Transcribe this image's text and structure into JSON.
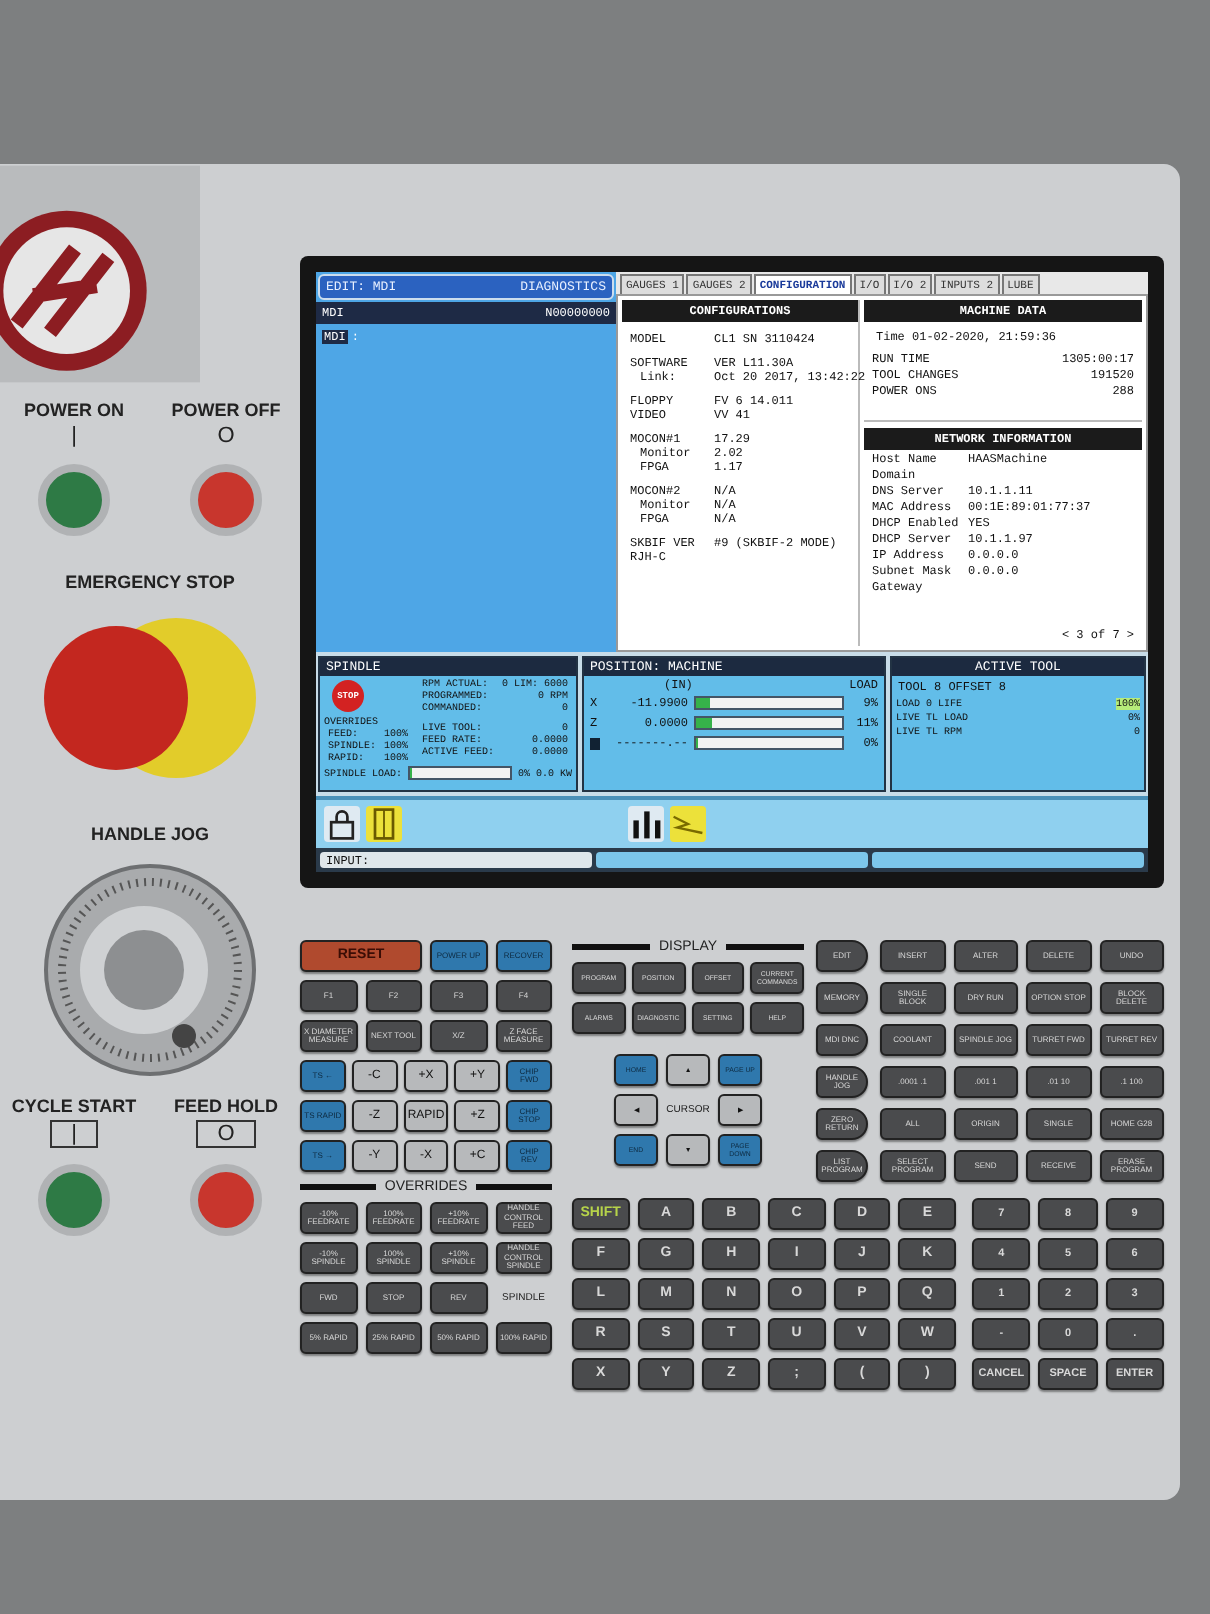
{
  "side_panel": {
    "power_on": {
      "label": "POWER ON",
      "symbol": "|"
    },
    "power_off": {
      "label": "POWER OFF",
      "symbol": "O"
    },
    "emergency_stop": {
      "label": "EMERGENCY STOP"
    },
    "handle_jog": {
      "label": "HANDLE JOG"
    },
    "cycle_start": {
      "label": "CYCLE START",
      "symbol": "|"
    },
    "feed_hold": {
      "label": "FEED HOLD",
      "symbol": "O"
    }
  },
  "screen": {
    "left_pane": {
      "title": "EDIT: MDI",
      "tab": "DIAGNOSTICS",
      "header": "MDI",
      "program": "N00000000",
      "line": {
        "label": "MDI",
        "text": ":"
      }
    },
    "tabs": [
      {
        "label": "GAUGES 1",
        "selected": false
      },
      {
        "label": "GAUGES 2",
        "selected": false
      },
      {
        "label": "CONFIGURATION",
        "selected": true
      },
      {
        "label": "I/O",
        "selected": false
      },
      {
        "label": "I/O 2",
        "selected": false
      },
      {
        "label": "INPUTS 2",
        "selected": false
      },
      {
        "label": "LUBE",
        "selected": false
      }
    ],
    "configurations": {
      "title": "CONFIGURATIONS",
      "groups": [
        [
          {
            "label": "MODEL",
            "value": "CL1   SN   3110424",
            "indent": false
          }
        ],
        [
          {
            "label": "SOFTWARE",
            "value": "VER L11.30A",
            "indent": false
          },
          {
            "label": "Link:",
            "value": "Oct 20 2017, 13:42:22",
            "indent": true
          }
        ],
        [
          {
            "label": "FLOPPY",
            "value": "FV 6  14.011",
            "indent": false
          },
          {
            "label": "VIDEO",
            "value": "VV 41",
            "indent": false
          }
        ],
        [
          {
            "label": "MOCON#1",
            "value": "17.29",
            "indent": false
          },
          {
            "label": "Monitor",
            "value": "2.02",
            "indent": true
          },
          {
            "label": "FPGA",
            "value": "1.17",
            "indent": true
          }
        ],
        [
          {
            "label": "MOCON#2",
            "value": "N/A",
            "indent": false
          },
          {
            "label": "Monitor",
            "value": "N/A",
            "indent": true
          },
          {
            "label": "FPGA",
            "value": "N/A",
            "indent": true
          }
        ],
        [
          {
            "label": "SKBIF VER",
            "value": "#9 (SKBIF-2 MODE)",
            "indent": false
          },
          {
            "label": "RJH-C",
            "indent": false
          }
        ]
      ]
    },
    "machine_data": {
      "title": "MACHINE DATA",
      "time": "Time  01-02-2020, 21:59:36",
      "rows": [
        {
          "label": "RUN TIME",
          "value": "1305:00:17"
        },
        {
          "label": "TOOL CHANGES",
          "value": "191520"
        },
        {
          "label": "POWER ONS",
          "value": "288"
        }
      ]
    },
    "network": {
      "title": "NETWORK INFORMATION",
      "rows": [
        {
          "label": "Host Name",
          "value": "HAASMachine"
        },
        {
          "label": "Domain"
        },
        {
          "label": "DNS Server",
          "value": "10.1.1.11"
        },
        {
          "label": "MAC Address",
          "value": "00:1E:89:01:77:37"
        },
        {
          "label": "DHCP Enabled",
          "value": "YES"
        },
        {
          "label": "DHCP Server",
          "value": "10.1.1.97"
        },
        {
          "label": "IP Address",
          "value": "0.0.0.0"
        },
        {
          "label": "Subnet Mask",
          "value": "0.0.0.0"
        },
        {
          "label": "Gateway"
        }
      ]
    },
    "pager": "< 3 of 7 >",
    "spindle": {
      "title": "SPINDLE",
      "stop": "STOP",
      "rows": [
        {
          "label": "RPM ACTUAL:",
          "value": "0 LIM: 6000"
        },
        {
          "label": "PROGRAMMED:",
          "value": "0      RPM"
        },
        {
          "label": "COMMANDED:",
          "value": "0"
        }
      ],
      "overrides_title": "OVERRIDES",
      "overrides": [
        {
          "label": "FEED:",
          "value": "100%"
        },
        {
          "label": "SPINDLE:",
          "value": "100%"
        },
        {
          "label": "RAPID:",
          "value": "100%"
        }
      ],
      "rows2": [
        {
          "label": "LIVE TOOL:",
          "value": "0"
        },
        {
          "label": "FEED RATE:",
          "value": "0.0000"
        },
        {
          "label": "ACTIVE FEED:",
          "value": "0.0000"
        }
      ],
      "load_label": "SPINDLE LOAD:",
      "load_bar": {
        "level": 0
      },
      "load_reading": "0%",
      "power_reading": "0.0 KW"
    },
    "position": {
      "title": "POSITION: MACHINE",
      "units": "(IN)",
      "load_title": "LOAD",
      "axes": [
        {
          "axis": "X",
          "value": "-11.9900",
          "level": 0.09,
          "load": "9%",
          "cursor": false
        },
        {
          "axis": "Z",
          "value": "0.0000",
          "level": 0.11,
          "load": "11%",
          "cursor": false
        },
        {
          "value": "-------.--",
          "level": 0,
          "load": "0%",
          "cursor": true
        }
      ]
    },
    "active_tool": {
      "title": "ACTIVE TOOL",
      "tool": "TOOL 8  OFFSET 8",
      "rows": [
        {
          "label": "LOAD 0  LIFE",
          "value": "100%",
          "highlighted": true
        },
        {
          "label": "LIVE TL LOAD",
          "value": "0%",
          "highlighted": false
        },
        {
          "label": "LIVE TL RPM",
          "value": "0",
          "highlighted": false
        }
      ]
    },
    "status_icons": [
      {
        "kind": "lock",
        "highlighted": false
      },
      {
        "kind": "door",
        "highlighted": true
      },
      {
        "kind": "bars",
        "highlighted": false
      },
      {
        "kind": "zigzag",
        "highlighted": true
      }
    ],
    "input": {
      "label": "INPUT:"
    }
  },
  "keypad": {
    "left_rows": [
      [
        {
          "label": "RESET",
          "kind": "reset"
        },
        {
          "label": "POWER UP",
          "kind": "blue"
        },
        {
          "label": "RECOVER",
          "kind": "blue"
        }
      ],
      [
        {
          "label": "F1",
          "kind": "dark"
        },
        {
          "label": "F2",
          "kind": "dark"
        },
        {
          "label": "F3",
          "kind": "dark"
        },
        {
          "label": "F4",
          "kind": "dark"
        }
      ],
      [
        {
          "label": "X DIAMETER MEASURE",
          "kind": "dark"
        },
        {
          "label": "NEXT TOOL",
          "kind": "dark"
        },
        {
          "label": "X/Z",
          "kind": "dark"
        },
        {
          "label": "Z FACE MEASURE",
          "kind": "dark"
        }
      ]
    ],
    "jog_rows": [
      [
        {
          "label": "TS ←",
          "kind": "blue"
        },
        {
          "label": "-C",
          "kind": "light"
        },
        {
          "label": "+X",
          "kind": "light"
        },
        {
          "label": "+Y",
          "kind": "light"
        },
        {
          "label": "CHIP FWD",
          "kind": "blue"
        }
      ],
      [
        {
          "label": "TS RAPID",
          "kind": "blue"
        },
        {
          "label": "-Z",
          "kind": "light"
        },
        {
          "label": "RAPID",
          "kind": "light"
        },
        {
          "label": "+Z",
          "kind": "light"
        },
        {
          "label": "CHIP STOP",
          "kind": "blue"
        }
      ],
      [
        {
          "label": "TS →",
          "kind": "blue"
        },
        {
          "label": "-Y",
          "kind": "light"
        },
        {
          "label": "-X",
          "kind": "light"
        },
        {
          "label": "+C",
          "kind": "light"
        },
        {
          "label": "CHIP REV",
          "kind": "blue"
        }
      ]
    ],
    "overrides": {
      "title": "OVERRIDES",
      "rows": [
        [
          {
            "label": "-10% FEEDRATE",
            "kind": "dark"
          },
          {
            "label": "100% FEEDRATE",
            "kind": "dark"
          },
          {
            "label": "+10% FEEDRATE",
            "kind": "dark"
          },
          {
            "label": "HANDLE CONTROL FEED",
            "kind": "dark"
          }
        ],
        [
          {
            "label": "-10% SPINDLE",
            "kind": "dark"
          },
          {
            "label": "100% SPINDLE",
            "kind": "dark"
          },
          {
            "label": "+10% SPINDLE",
            "kind": "dark"
          },
          {
            "label": "HANDLE CONTROL SPINDLE",
            "kind": "dark"
          }
        ],
        [
          {
            "label": "FWD",
            "kind": "dark"
          },
          {
            "label": "STOP",
            "kind": "dark"
          },
          {
            "label": "REV",
            "kind": "dark"
          },
          {
            "label": "SPINDLE",
            "kind": "label"
          }
        ],
        [
          {
            "label": "5% RAPID",
            "kind": "dark"
          },
          {
            "label": "25% RAPID",
            "kind": "dark"
          },
          {
            "label": "50% RAPID",
            "kind": "dark"
          },
          {
            "label": "100% RAPID",
            "kind": "dark"
          }
        ]
      ]
    },
    "display": {
      "title": "DISPLAY",
      "rows": [
        [
          {
            "label": "PROGRAM"
          },
          {
            "label": "POSITION"
          },
          {
            "label": "OFFSET"
          },
          {
            "label": "CURRENT COMMANDS"
          }
        ],
        [
          {
            "label": "ALARMS"
          },
          {
            "label": "DIAGNOSTIC"
          },
          {
            "label": "SETTING"
          },
          {
            "label": "HELP"
          }
        ]
      ]
    },
    "cursor": {
      "label": "CURSOR",
      "keys": [
        {
          "label": "HOME",
          "kind": "blue"
        },
        {
          "label": "▲",
          "kind": "light"
        },
        {
          "label": "PAGE UP",
          "kind": "blue"
        },
        {
          "label": "◀",
          "kind": "light"
        },
        {
          "label": "▶",
          "kind": "light"
        },
        {
          "label": "END",
          "kind": "blue"
        },
        {
          "label": "▼",
          "kind": "light"
        },
        {
          "label": "PAGE DOWN",
          "kind": "blue"
        }
      ]
    },
    "mode_keys": [
      {
        "label": "EDIT"
      },
      {
        "label": "MEMORY"
      },
      {
        "label": "MDI DNC"
      },
      {
        "label": "HANDLE JOG"
      },
      {
        "label": "ZERO RETURN"
      },
      {
        "label": "LIST PROGRAM"
      }
    ],
    "edit_rows": [
      [
        {
          "label": "INSERT"
        },
        {
          "label": "ALTER"
        },
        {
          "label": "DELETE"
        },
        {
          "label": "UNDO"
        }
      ],
      [
        {
          "label": "SINGLE BLOCK"
        },
        {
          "label": "DRY RUN"
        },
        {
          "label": "OPTION STOP"
        },
        {
          "label": "BLOCK DELETE"
        }
      ],
      [
        {
          "label": "COOLANT"
        },
        {
          "label": "SPINDLE JOG"
        },
        {
          "label": "TURRET FWD"
        },
        {
          "label": "TURRET REV"
        }
      ],
      [
        {
          "label": ".0001 .1"
        },
        {
          "label": ".001 1"
        },
        {
          "label": ".01 10"
        },
        {
          "label": ".1 100"
        }
      ],
      [
        {
          "label": "ALL"
        },
        {
          "label": "ORIGIN"
        },
        {
          "label": "SINGLE"
        },
        {
          "label": "HOME G28"
        }
      ],
      [
        {
          "label": "SELECT PROGRAM"
        },
        {
          "label": "SEND"
        },
        {
          "label": "RECEIVE"
        },
        {
          "label": "ERASE PROGRAM"
        }
      ]
    ],
    "alpha_rows": [
      [
        {
          "label": "SHIFT",
          "kind": "shift"
        },
        {
          "label": "A",
          "kind": "dark"
        },
        {
          "label": "B",
          "kind": "dark"
        },
        {
          "label": "C",
          "kind": "dark"
        },
        {
          "label": "D",
          "kind": "dark"
        },
        {
          "label": "E",
          "kind": "dark"
        }
      ],
      [
        {
          "label": "F",
          "kind": "dark"
        },
        {
          "label": "G",
          "kind": "dark"
        },
        {
          "label": "H",
          "kind": "dark"
        },
        {
          "label": "I",
          "kind": "dark"
        },
        {
          "label": "J",
          "kind": "dark"
        },
        {
          "label": "K",
          "kind": "dark"
        }
      ],
      [
        {
          "label": "L",
          "kind": "dark"
        },
        {
          "label": "M",
          "kind": "dark"
        },
        {
          "label": "N",
          "kind": "dark"
        },
        {
          "label": "O",
          "kind": "dark"
        },
        {
          "label": "P",
          "kind": "dark"
        },
        {
          "label": "Q",
          "kind": "dark"
        }
      ],
      [
        {
          "label": "R",
          "kind": "dark"
        },
        {
          "label": "S",
          "kind": "dark"
        },
        {
          "label": "T",
          "kind": "dark"
        },
        {
          "label": "U",
          "kind": "dark"
        },
        {
          "label": "V",
          "kind": "dark"
        },
        {
          "label": "W",
          "kind": "dark"
        }
      ],
      [
        {
          "label": "X",
          "kind": "dark"
        },
        {
          "label": "Y",
          "kind": "dark"
        },
        {
          "label": "Z",
          "kind": "dark"
        },
        {
          "label": ";",
          "kind": "dark"
        },
        {
          "label": "(",
          "kind": "dark"
        },
        {
          "label": ")",
          "kind": "dark"
        }
      ]
    ],
    "numeric_rows": [
      [
        {
          "label": "7"
        },
        {
          "label": "8"
        },
        {
          "label": "9"
        }
      ],
      [
        {
          "label": "4"
        },
        {
          "label": "5"
        },
        {
          "label": "6"
        }
      ],
      [
        {
          "label": "1"
        },
        {
          "label": "2"
        },
        {
          "label": "3"
        }
      ],
      [
        {
          "label": "-"
        },
        {
          "label": "0"
        },
        {
          "label": "."
        }
      ],
      [
        {
          "label": "CANCEL"
        },
        {
          "label": "SPACE"
        },
        {
          "label": "ENTER"
        }
      ]
    ]
  }
}
